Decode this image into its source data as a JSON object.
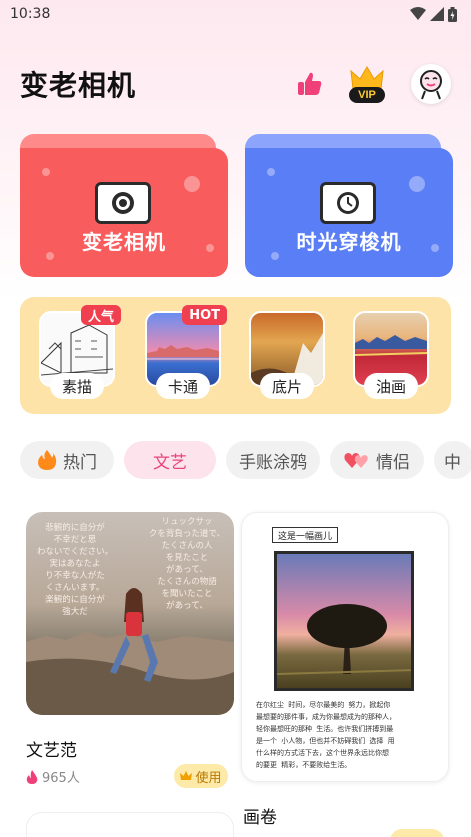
{
  "status_bar": {
    "time": "10:38"
  },
  "header": {
    "title": "变老相机",
    "vip_label": "VIP"
  },
  "hero_cards": [
    {
      "label": "变老相机",
      "color": "#f95c5c"
    },
    {
      "label": "时光穿梭机",
      "color": "#5a7ef5"
    }
  ],
  "styles": [
    {
      "label": "素描",
      "badge": "人气"
    },
    {
      "label": "卡通",
      "badge": "HOT"
    },
    {
      "label": "底片",
      "badge": ""
    },
    {
      "label": "油画",
      "badge": ""
    }
  ],
  "tabs": [
    {
      "label": "热门",
      "active": false
    },
    {
      "label": "文艺",
      "active": true
    },
    {
      "label": "手账涂鸦",
      "active": false
    },
    {
      "label": "情侣",
      "active": false
    },
    {
      "label": "中",
      "active": false
    }
  ],
  "templates": [
    {
      "title": "文艺范",
      "count": "965人",
      "use_label": "使用",
      "poem_left": [
        "悲観的に自分が",
        "不幸だと思",
        "わないでください。",
        "実はあなたよ",
        "り不幸な人がた",
        "くさんいます。",
        "楽観的に自分が",
        "強大だ"
      ],
      "poem_right": [
        "リュックサッ",
        "クを背負った道で、",
        "たくさんの人",
        "を見たこと",
        "があって、",
        "たくさんの物語",
        "を聞いたこと",
        "があって、"
      ]
    },
    {
      "title": "画卷",
      "caption": "这是一幅画儿",
      "note_lines": [
        "在尔红尘 时间，尽尔最美的 努力，掀起你",
        "最想要的那件事，成为你最想成为的那种人，",
        "轻你最想旺的那种 生活。也许我们拼搏到最",
        "是一个 小人物，但也并不妨碍我们 选择 用",
        "什么样的方式活下去，这个世界永远比你想",
        "的要更 精彩，不要败给生活。"
      ]
    }
  ],
  "colors": {
    "accent_pink": "#e8457a",
    "hero_red": "#f95c5c",
    "hero_blue": "#5a7ef5",
    "style_panel": "#fde3a8",
    "hot_badge": "#f0404f"
  }
}
